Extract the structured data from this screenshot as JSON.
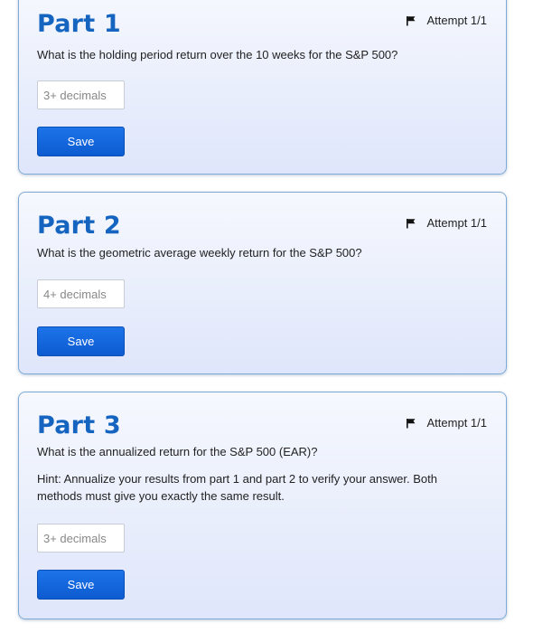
{
  "parts": [
    {
      "title": "Part 1",
      "attempt": "Attempt 1/1",
      "question": "What is the holding period return over the 10 weeks for the S&P 500?",
      "input_placeholder": "3+ decimals",
      "input_value": "",
      "save_label": "Save"
    },
    {
      "title": "Part 2",
      "attempt": "Attempt 1/1",
      "question": "What is the geometric average weekly return for the S&P 500?",
      "input_placeholder": "4+ decimals",
      "input_value": "",
      "save_label": "Save"
    },
    {
      "title": "Part 3",
      "attempt": "Attempt 1/1",
      "question": "What is the annualized return for the S&P 500 (EAR)?",
      "hint": "Hint: Annualize your results from part 1 and part 2 to verify your answer. Both methods must give you exactly the same result.",
      "input_placeholder": "3+ decimals",
      "input_value": "",
      "save_label": "Save"
    }
  ],
  "icons": {
    "flag": "flag-icon"
  },
  "colors": {
    "title": "#1565c0",
    "button": "#0d5bd1",
    "card_border": "#7eaad6",
    "card_background": "#e9eefc"
  }
}
